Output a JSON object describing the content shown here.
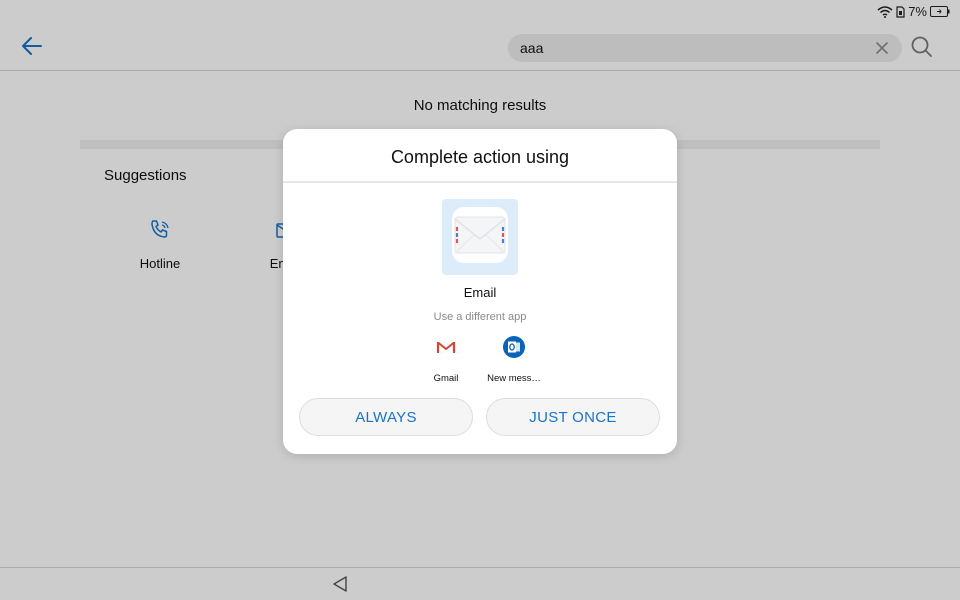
{
  "status_bar": {
    "battery_percent": "7%"
  },
  "top_bar": {
    "back_icon": "arrow-left-icon",
    "search": {
      "value": "aaa",
      "clear_icon": "close-icon",
      "search_icon": "search-icon"
    }
  },
  "content": {
    "no_results": "No matching results",
    "suggestions_title": "Suggestions",
    "suggestions": [
      {
        "label": "Hotline",
        "icon": "phone-icon"
      },
      {
        "label": "Email",
        "icon": "email-icon"
      }
    ]
  },
  "dialog": {
    "title": "Complete action using",
    "primary_app": {
      "label": "Email",
      "icon": "email-app-icon"
    },
    "alt_label": "Use a different app",
    "alt_apps": [
      {
        "label": "Gmail",
        "icon": "gmail-icon"
      },
      {
        "label": "New mess…",
        "icon": "outlook-icon"
      }
    ],
    "buttons": {
      "always": "ALWAYS",
      "just_once": "JUST ONCE"
    }
  },
  "nav_bar": {
    "back_icon": "nav-back-icon"
  },
  "colors": {
    "accent": "#1a73c8",
    "overlay": "rgba(0,0,0,0.2)",
    "dialog_bg": "#ffffff"
  }
}
